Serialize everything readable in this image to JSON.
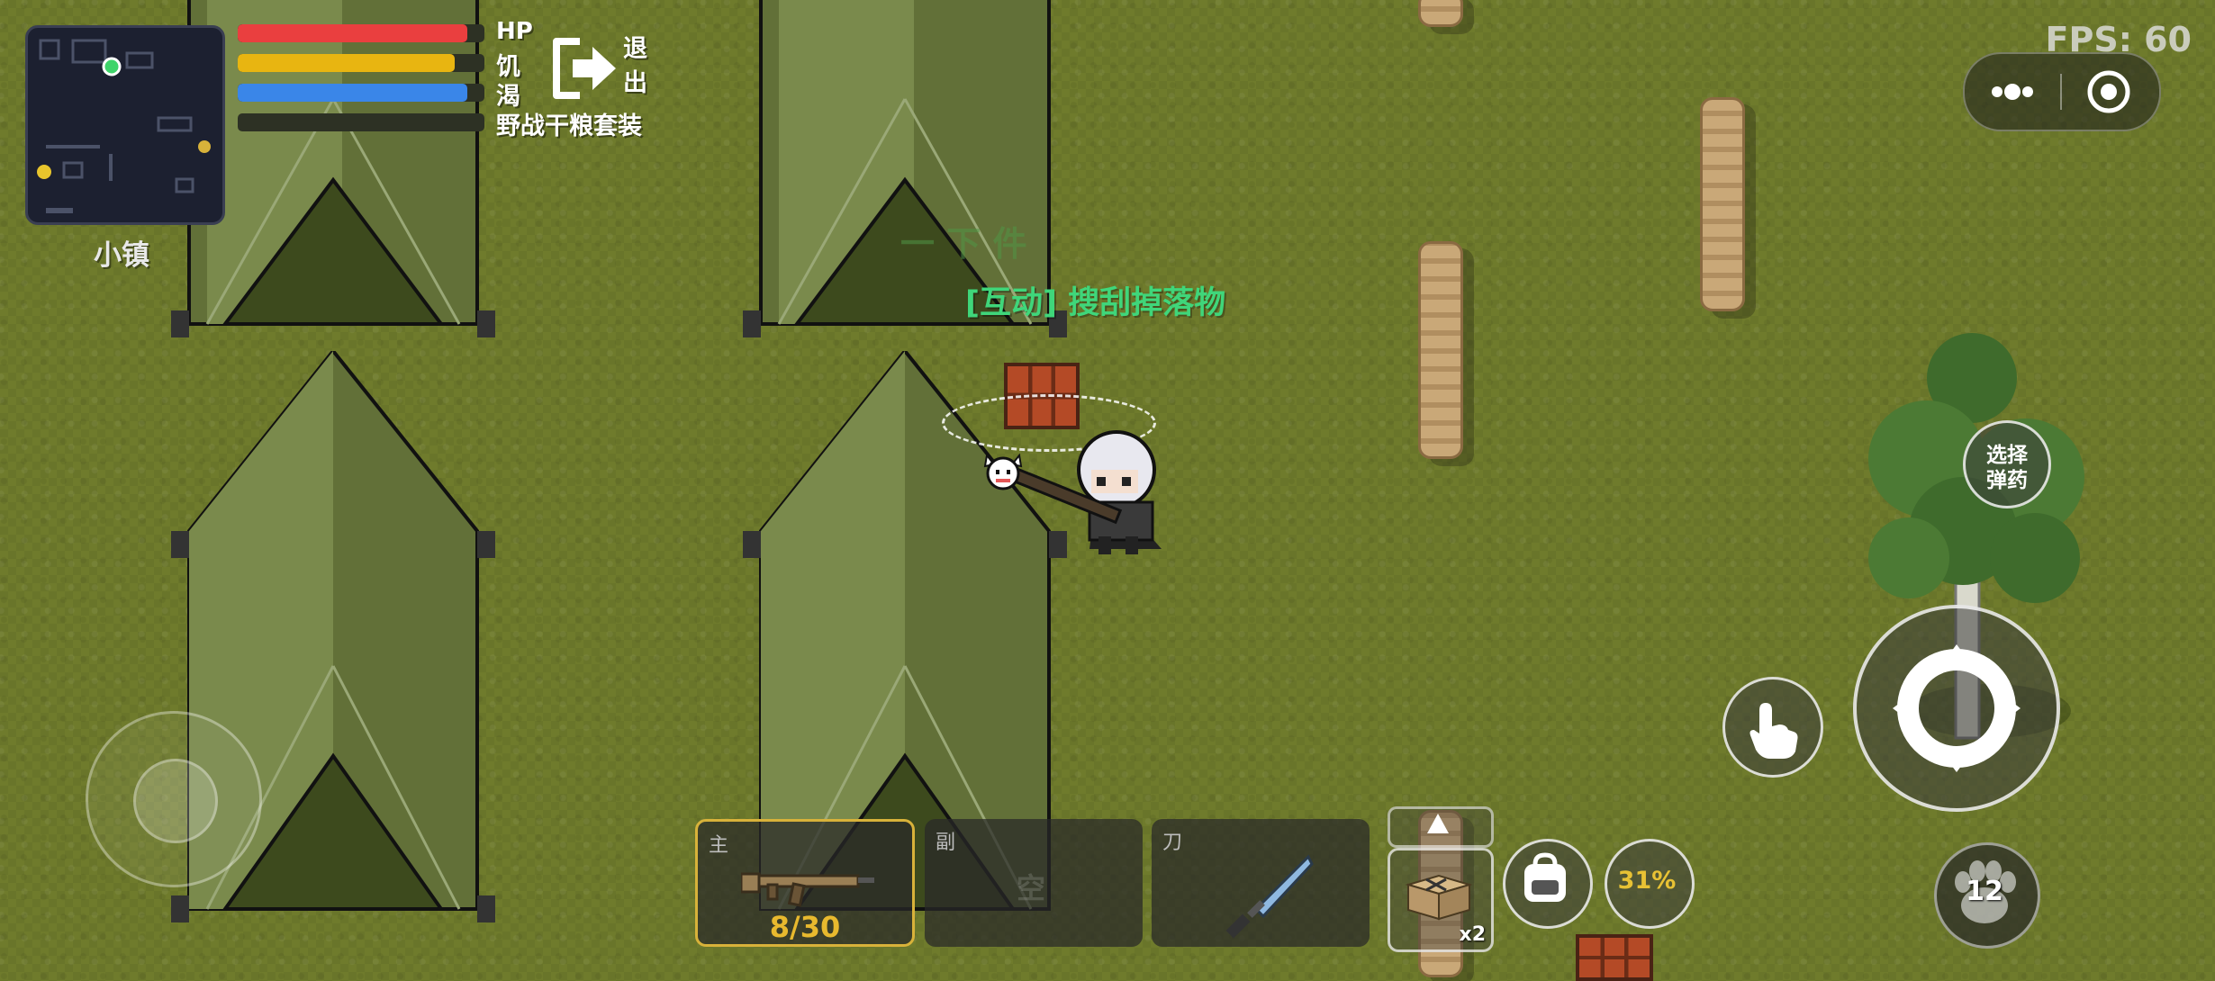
{
  "hud": {
    "hp_label": "HP",
    "hunger_label": "饥",
    "thirst_label": "渴",
    "food_item": "野战干粮套装",
    "exit_label_1": "退",
    "exit_label_2": "出",
    "hp_level": 0.93,
    "hunger_level": 0.88,
    "thirst_level": 0.93,
    "hp_color": "#ea3f3f",
    "hunger_color": "#e8b511",
    "thirst_color": "#3a86e8"
  },
  "minimap": {
    "location_name": "小镇"
  },
  "fps": "FPS: 60",
  "world": {
    "interact_prompt": "[互动] 搜刮掉落物",
    "faded_text": "一 下 件"
  },
  "buttons": {
    "select_ammo_1": "选择",
    "select_ammo_2": "弹药",
    "battery_percent": "31%",
    "pet_count": "12",
    "item_count": "x2"
  },
  "weapon_slots": [
    {
      "label": "主",
      "value": "8/30",
      "icon": "assault-rifle-icon"
    },
    {
      "label": "副",
      "value": "空",
      "icon": "empty"
    },
    {
      "label": "刀",
      "value": "",
      "icon": "knife-icon"
    }
  ]
}
